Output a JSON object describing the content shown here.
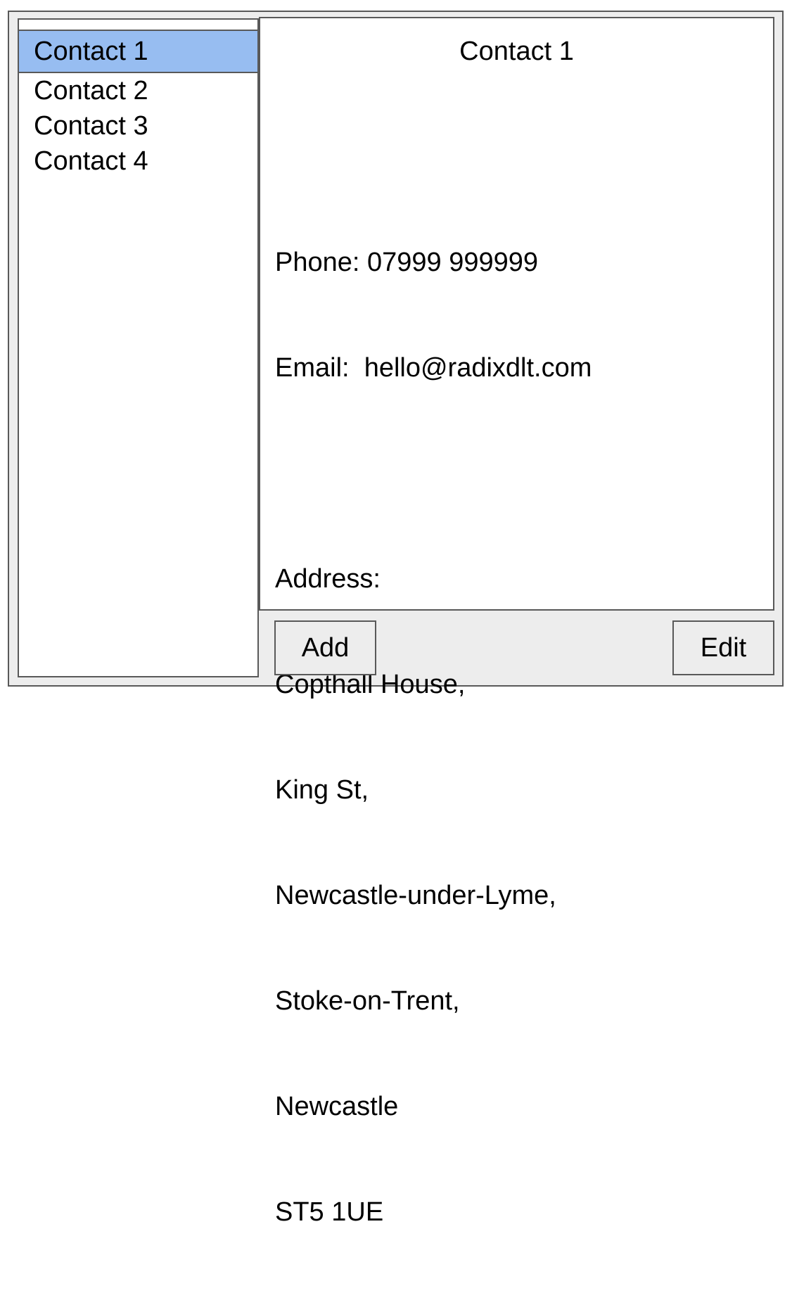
{
  "contacts": [
    {
      "label": "Contact 1",
      "selected": true
    },
    {
      "label": "Contact 2",
      "selected": false
    },
    {
      "label": "Contact 3",
      "selected": false
    },
    {
      "label": "Contact 4",
      "selected": false
    }
  ],
  "detail": {
    "title": "Contact 1",
    "phone": "Phone: 07999 999999",
    "email": "Email:  hello@radixdlt.com",
    "address_label": "Address:",
    "address_lines": [
      "Copthall House,",
      "King St,",
      "Newcastle-under-Lyme,",
      "Stoke-on-Trent,",
      "Newcastle",
      "ST5 1UE"
    ]
  },
  "buttons": {
    "add_label": "Add",
    "edit_label": "Edit"
  },
  "colors": {
    "selected_row": "#97bdf1",
    "border": "#595959",
    "window_bg": "#ededed"
  }
}
